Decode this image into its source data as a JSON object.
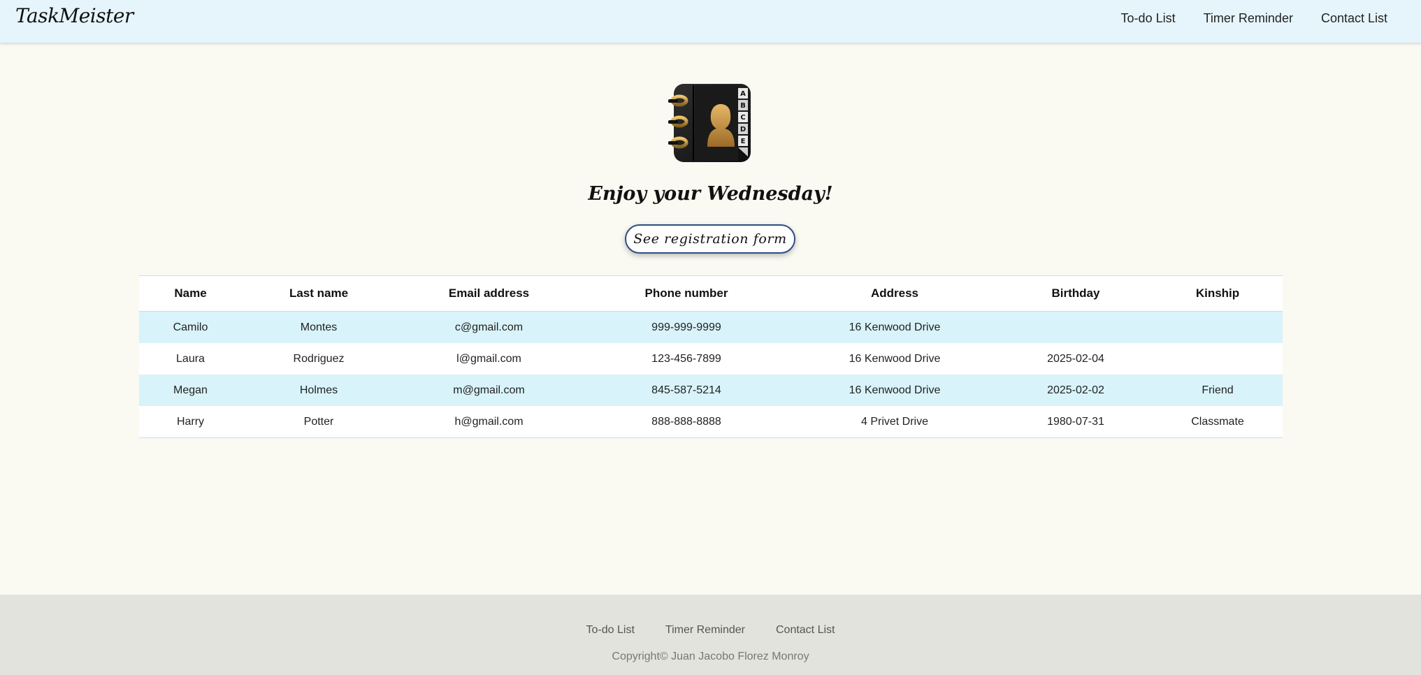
{
  "navbar": {
    "brand": "TaskMeister",
    "links": [
      "To-do List",
      "Timer Reminder",
      "Contact List"
    ]
  },
  "hero": {
    "icon": "address-book-icon",
    "icon_tabs": [
      "A",
      "B",
      "C",
      "D",
      "E"
    ],
    "greeting": "Enjoy your Wednesday!",
    "button_label": "See registration form"
  },
  "table": {
    "headers": [
      "Name",
      "Last name",
      "Email address",
      "Phone number",
      "Address",
      "Birthday",
      "Kinship"
    ],
    "rows": [
      [
        "Camilo",
        "Montes",
        "c@gmail.com",
        "999-999-9999",
        "16 Kenwood Drive",
        "",
        ""
      ],
      [
        "Laura",
        "Rodriguez",
        "l@gmail.com",
        "123-456-7899",
        "16 Kenwood Drive",
        "2025-02-04",
        ""
      ],
      [
        "Megan",
        "Holmes",
        "m@gmail.com",
        "845-587-5214",
        "16 Kenwood Drive",
        "2025-02-02",
        "Friend"
      ],
      [
        "Harry",
        "Potter",
        "h@gmail.com",
        "888-888-8888",
        "4 Privet Drive",
        "1980-07-31",
        "Classmate"
      ]
    ]
  },
  "footer": {
    "links": [
      "To-do List",
      "Timer Reminder",
      "Contact List"
    ],
    "copyright": "Copyright© Juan Jacobo Florez Monroy"
  },
  "colors": {
    "navbar_bg": "#e6f5fb",
    "page_bg": "#faf9f2",
    "row_stripe": "#d8f3fa",
    "button_border": "#2d4e86",
    "footer_bg": "#e3e3de"
  }
}
